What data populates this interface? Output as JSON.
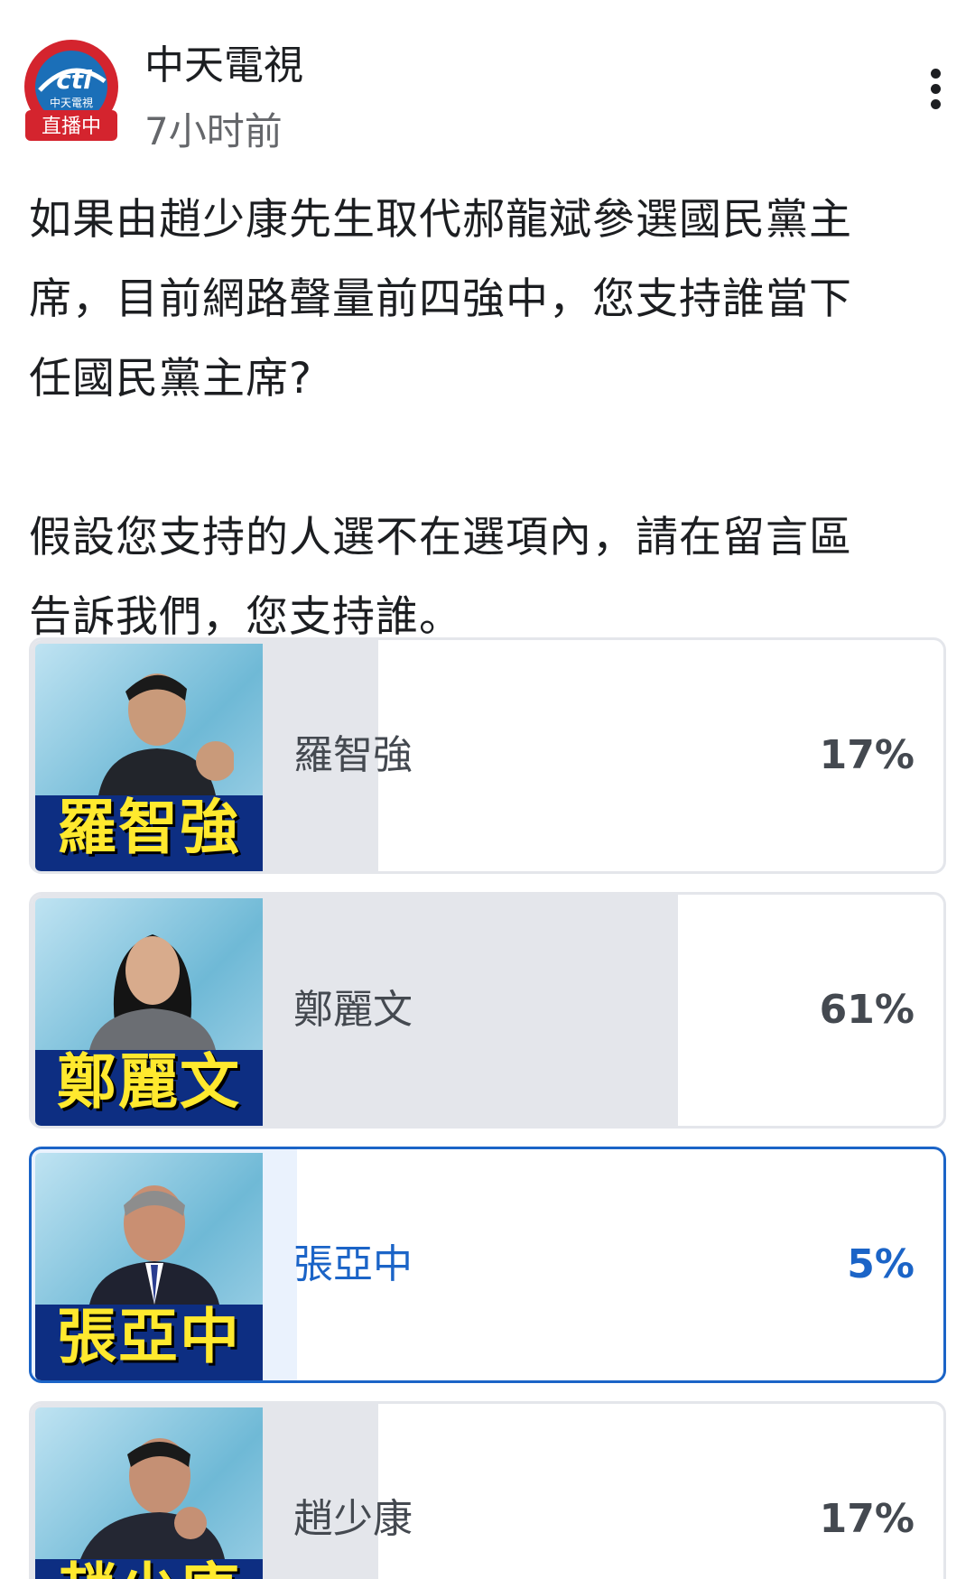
{
  "post": {
    "page_name": "中天電視",
    "time": "7小时前",
    "avatar": {
      "logo_text": "cti",
      "channel_text": "中天電視",
      "badge_text": "直播中",
      "brand_color": "#d4242e",
      "logo_color": "#1b6fb8"
    },
    "text_lines": [
      "如果由趙少康先生取代郝龍斌參選國民黨主",
      "席，目前網路聲量前四強中，您支持誰當下",
      "任國民黨主席?",
      "假設您支持的人選不在選項內，請在留言區",
      "告訴我們，您支持誰。"
    ]
  },
  "poll": {
    "options": [
      {
        "label": "羅智強",
        "photo_caption": "羅智強",
        "percent": "17%",
        "fill": 17,
        "selected": false
      },
      {
        "label": "鄭麗文",
        "photo_caption": "鄭麗文",
        "percent": "61%",
        "fill": 61,
        "selected": false
      },
      {
        "label": "張亞中",
        "photo_caption": "張亞中",
        "percent": "5%",
        "fill": 5,
        "selected": true
      },
      {
        "label": "趙少康",
        "photo_caption": "趙少康",
        "percent": "17%",
        "fill": 17,
        "selected": false
      }
    ]
  },
  "colors": {
    "selected": "#1b64c7",
    "bar": "#e4e6eb",
    "caption": "#ffe92e",
    "caption_band": "#0d2e82"
  }
}
